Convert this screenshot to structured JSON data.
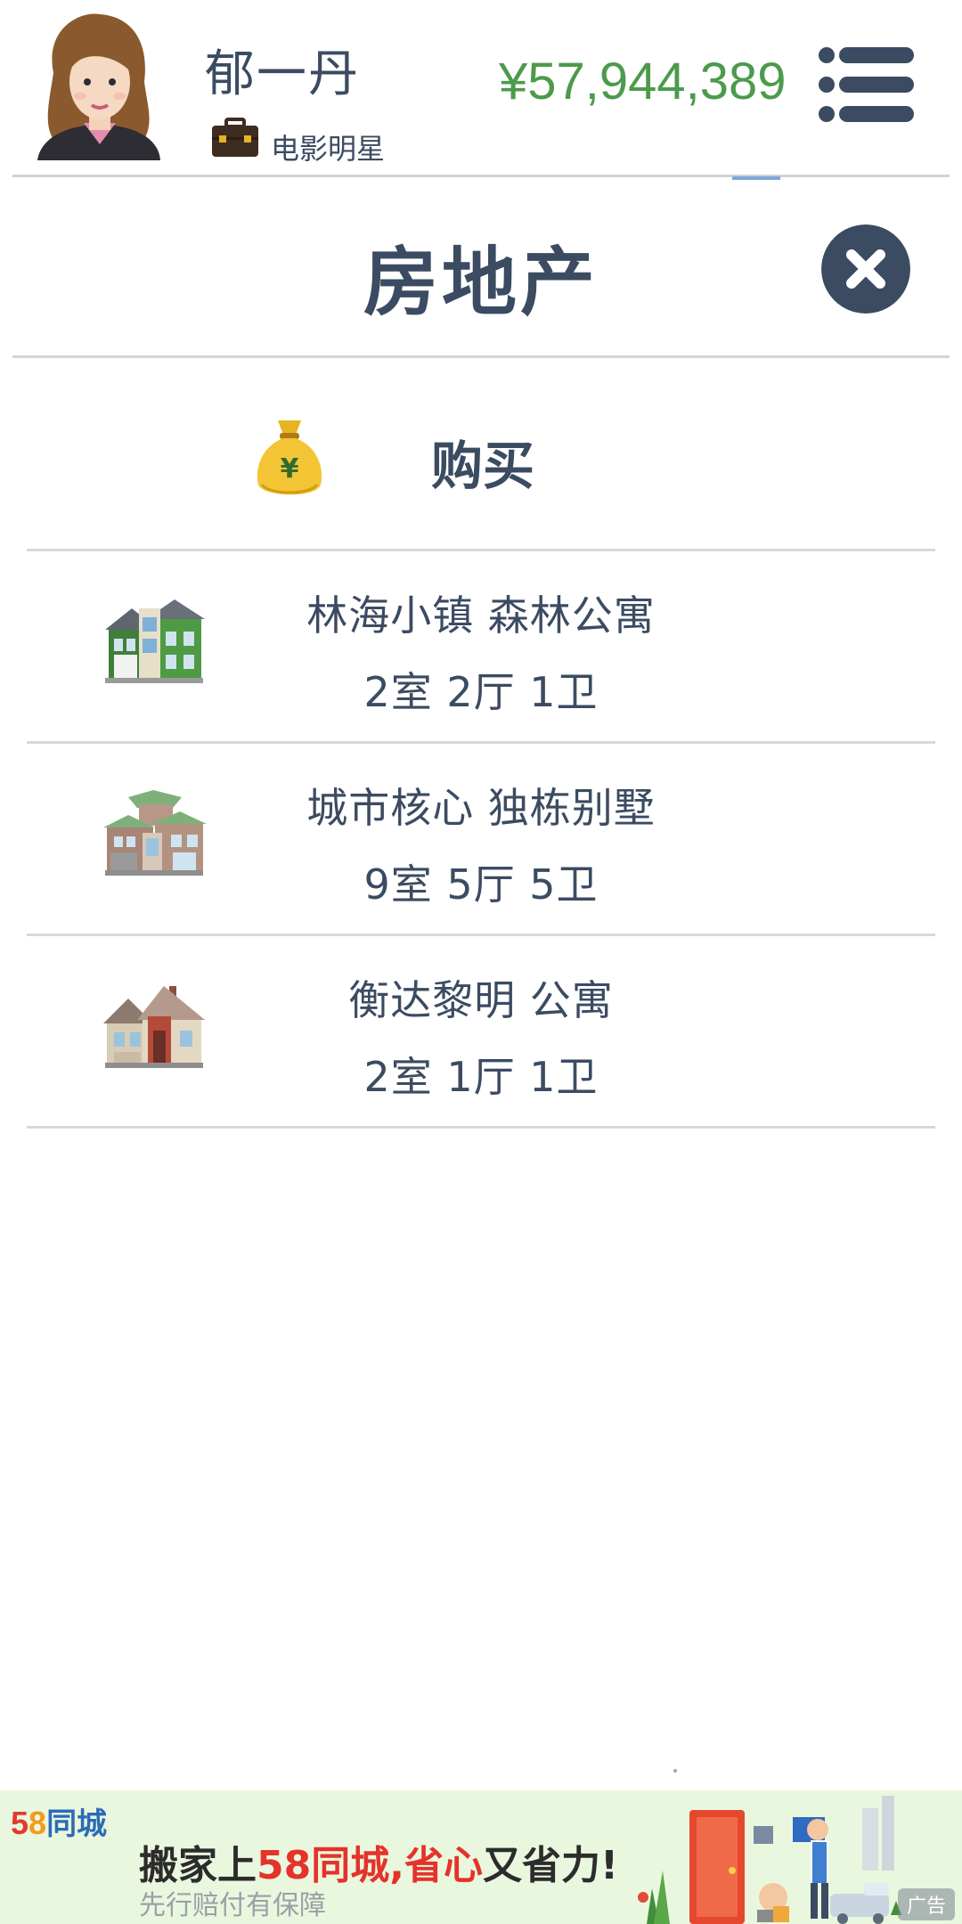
{
  "header": {
    "player_name": "郁一丹",
    "job": "电影明星",
    "money": "¥57,944,389",
    "avatar_icon": "woman-avatar-icon",
    "job_icon": "briefcase-icon",
    "menu_icon": "list-menu-icon"
  },
  "page": {
    "title": "房地产",
    "close_icon": "close-icon"
  },
  "buy_tab": {
    "label": "购买",
    "icon": "money-bag-icon"
  },
  "properties": [
    {
      "name": "林海小镇 森林公寓",
      "rooms": "2室 2厅 1卫",
      "icon": "green-house-icon"
    },
    {
      "name": "城市核心 独栋别墅",
      "rooms": "9室 5厅 5卫",
      "icon": "villa-icon"
    },
    {
      "name": "衡达黎明 公寓",
      "rooms": "2室 1厅 1卫",
      "icon": "cottage-icon"
    }
  ],
  "ad": {
    "logo_5": "5",
    "logo_8": "8",
    "logo_name": "同城",
    "headline_pre": "搬家上",
    "headline_hl": "58同城,省心",
    "headline_post": "又省力!",
    "subline": "先行赔付有保障",
    "tag": "广告"
  },
  "colors": {
    "text": "#3b4b61",
    "money": "#4c9a4c",
    "divider": "#d6d9dc",
    "ad_bg": "#eaf7df",
    "ad_highlight": "#e4332a"
  }
}
